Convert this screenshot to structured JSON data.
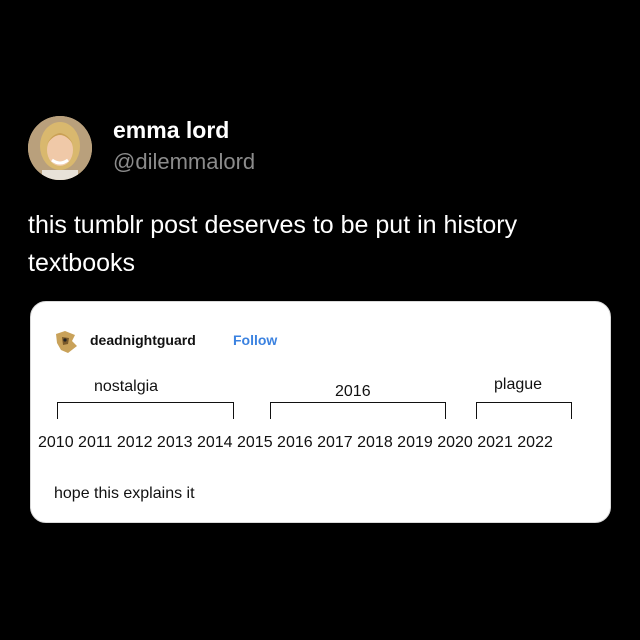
{
  "tweet": {
    "author_name": "emma lord",
    "author_handle": "@dilemmalord",
    "text": "this tumblr post deserves to be put in history textbooks"
  },
  "tumblr_post": {
    "username": "deadnightguard",
    "follow_label": "Follow",
    "labels": {
      "nostalgia": "nostalgia",
      "mid": "2016",
      "plague": "plague"
    },
    "years": "2010 2011 2012 2013 2014 2015 2016 2017 2018 2019 2020 2021 2022",
    "caption": "hope this explains it"
  },
  "colors": {
    "background": "#000000",
    "handle": "#8b8b8b",
    "follow": "#3b82e0",
    "card": "#ffffff"
  }
}
